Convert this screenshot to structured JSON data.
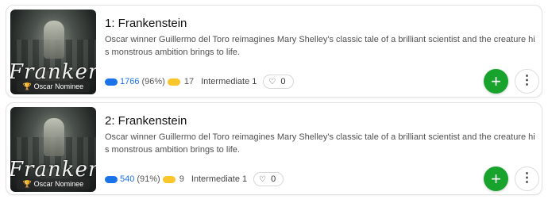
{
  "items": [
    {
      "title": "1: Frankenstein",
      "description": "Oscar winner Guillermo del Toro reimagines Mary Shelley's classic tale of a brilliant scientist and the creature his monstrous ambition brings to life.",
      "poster_text": "Frankenstein",
      "poster_badge": "Oscar Nominee",
      "vote_count": "1766",
      "vote_percent": "(96%)",
      "secondary_count": "17",
      "level": "Intermediate 1",
      "likes": "0",
      "add_icon": "plus-icon",
      "more_icon": "more-vert-icon"
    },
    {
      "title": "2: Frankenstein",
      "description": "Oscar winner Guillermo del Toro reimagines Mary Shelley's classic tale of a brilliant scientist and the creature his monstrous ambition brings to life.",
      "poster_text": "Frankenstein",
      "poster_badge": "Oscar Nominee",
      "vote_count": "540",
      "vote_percent": "(91%)",
      "secondary_count": "9",
      "level": "Intermediate 1",
      "likes": "0",
      "add_icon": "plus-icon",
      "more_icon": "more-vert-icon"
    }
  ],
  "colors": {
    "accent_blue": "#1a73e8",
    "accent_yellow": "#f9c62b",
    "add_green": "#18a32d"
  }
}
